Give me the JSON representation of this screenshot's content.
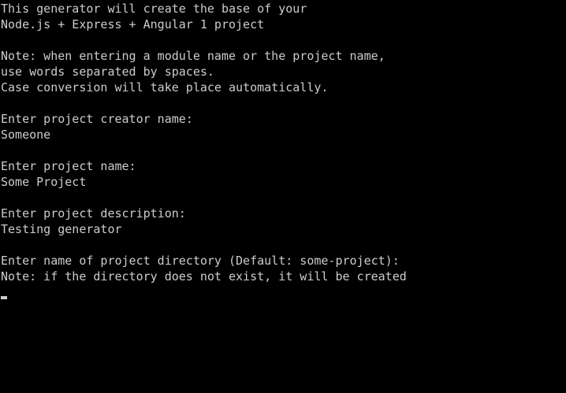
{
  "terminal": {
    "intro": {
      "line1": "This generator will create the base of your",
      "line2": "Node.js + Express + Angular 1 project"
    },
    "note": {
      "line1": "Note: when entering a module name or the project name,",
      "line2": "use words separated by spaces.",
      "line3": "Case conversion will take place automatically."
    },
    "creator": {
      "prompt": "Enter project creator name:",
      "answer": "Someone"
    },
    "project_name": {
      "prompt": "Enter project name:",
      "answer": "Some Project"
    },
    "description": {
      "prompt": "Enter project description:",
      "answer": "Testing generator"
    },
    "directory": {
      "prompt": "Enter name of project directory (Default: some-project):",
      "note": "Note: if the directory does not exist, it will be created"
    },
    "colors": {
      "background": "#000000",
      "foreground": "#cccccc"
    }
  }
}
